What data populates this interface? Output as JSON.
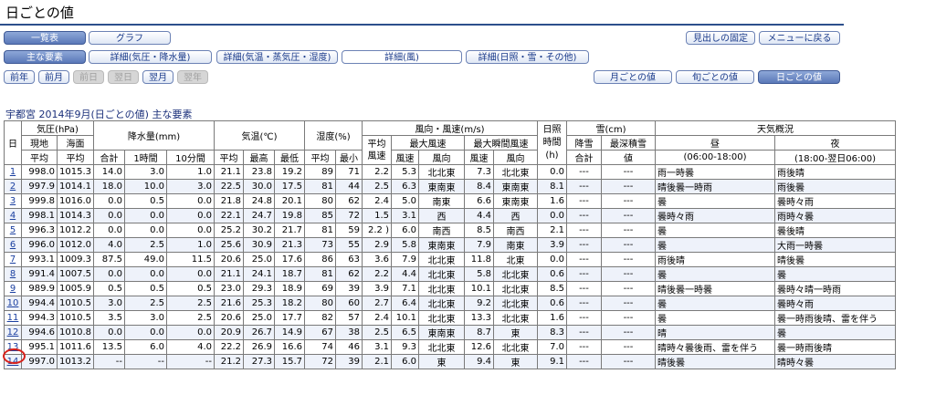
{
  "page": {
    "title": "日ごとの値"
  },
  "nav": {
    "row1": [
      {
        "label": "一覧表",
        "state": "active"
      },
      {
        "label": "グラフ",
        "state": "normal"
      }
    ],
    "row1_right": [
      {
        "label": "見出しの固定"
      },
      {
        "label": "メニューに戻る"
      }
    ],
    "row2": [
      {
        "label": "主な要素",
        "state": "active"
      },
      {
        "label": "詳細(気圧・降水量)",
        "state": "normal"
      },
      {
        "label": "詳細(気温・蒸気圧・湿度)",
        "state": "normal"
      },
      {
        "label": "詳細(風)",
        "state": "normal"
      },
      {
        "label": "詳細(日照・雪・その他)",
        "state": "normal"
      }
    ],
    "row3": [
      {
        "label": "前年",
        "state": "normal"
      },
      {
        "label": "前月",
        "state": "normal"
      },
      {
        "label": "前日",
        "state": "disabled"
      },
      {
        "label": "翌日",
        "state": "disabled"
      },
      {
        "label": "翌月",
        "state": "normal"
      },
      {
        "label": "翌年",
        "state": "disabled"
      }
    ],
    "row3_right": [
      {
        "label": "月ごとの値",
        "state": "normal"
      },
      {
        "label": "旬ごとの値",
        "state": "normal"
      },
      {
        "label": "日ごとの値",
        "state": "active"
      }
    ]
  },
  "table_title": "宇都宮 2014年9月(日ごとの値) 主な要素",
  "headers": {
    "day": "日",
    "pressure": "気圧(hPa)",
    "p_local": "現地",
    "p_sea": "海面",
    "avg": "平均",
    "precip": "降水量(mm)",
    "total": "合計",
    "max": "最大",
    "h1": "1時間",
    "m10": "10分間",
    "temp": "気温(℃)",
    "t_max": "最高",
    "t_min": "最低",
    "humid": "湿度(%)",
    "h_min": "最小",
    "wind": "風向・風速(m/s)",
    "avg_wind": "平均\n風速",
    "max_wind": "最大風速",
    "gust": "最大瞬間風速",
    "speed": "風速",
    "dir": "風向",
    "sun": "日照\n時間\n(h)",
    "snow": "雪(cm)",
    "snowfall": "降雪",
    "snow_total": "合計",
    "snow_depth": "最深積雪",
    "value": "値",
    "weather": "天気概況",
    "day_w": "昼",
    "day_range": "(06:00-18:00)",
    "night": "夜",
    "night_range": "(18:00-翌日06:00)"
  },
  "rows": [
    [
      "1",
      "998.0",
      "1015.3",
      "14.0",
      "3.0",
      "1.0",
      "21.1",
      "23.8",
      "19.2",
      "89",
      "71",
      "2.2",
      "5.3",
      "北北東",
      "7.3",
      "北北東",
      "0.0",
      "---",
      "---",
      "雨一時曇",
      "雨後晴"
    ],
    [
      "2",
      "997.9",
      "1014.1",
      "18.0",
      "10.0",
      "3.0",
      "22.5",
      "30.0",
      "17.5",
      "81",
      "44",
      "2.5",
      "6.3",
      "東南東",
      "8.4",
      "東南東",
      "8.1",
      "---",
      "---",
      "晴後曇一時雨",
      "雨後曇"
    ],
    [
      "3",
      "999.8",
      "1016.0",
      "0.0",
      "0.5",
      "0.0",
      "21.8",
      "24.8",
      "20.1",
      "80",
      "62",
      "2.4",
      "5.0",
      "南東",
      "6.6",
      "東南東",
      "1.6",
      "---",
      "---",
      "曇",
      "曇時々雨"
    ],
    [
      "4",
      "998.1",
      "1014.3",
      "0.0",
      "0.0",
      "0.0",
      "22.1",
      "24.7",
      "19.8",
      "85",
      "72",
      "1.5",
      "3.1",
      "西",
      "4.4",
      "西",
      "0.0",
      "---",
      "---",
      "曇時々雨",
      "雨時々曇"
    ],
    [
      "5",
      "996.3",
      "1012.2",
      "0.0",
      "0.0",
      "0.0",
      "25.2",
      "30.2",
      "21.7",
      "81",
      "59",
      "2.2 )",
      "6.0",
      "南西",
      "8.5",
      "南西",
      "2.1",
      "---",
      "---",
      "曇",
      "曇後晴"
    ],
    [
      "6",
      "996.0",
      "1012.0",
      "4.0",
      "2.5",
      "1.0",
      "25.6",
      "30.9",
      "21.3",
      "73",
      "55",
      "2.9",
      "5.8",
      "東南東",
      "7.9",
      "南東",
      "3.9",
      "---",
      "---",
      "曇",
      "大雨一時曇"
    ],
    [
      "7",
      "993.1",
      "1009.3",
      "87.5",
      "49.0",
      "11.5",
      "20.6",
      "25.0",
      "17.6",
      "86",
      "63",
      "3.6",
      "7.9",
      "北北東",
      "11.8",
      "北東",
      "0.0",
      "---",
      "---",
      "雨後晴",
      "晴後曇"
    ],
    [
      "8",
      "991.4",
      "1007.5",
      "0.0",
      "0.0",
      "0.0",
      "21.1",
      "24.1",
      "18.7",
      "81",
      "62",
      "2.2",
      "4.4",
      "北北東",
      "5.8",
      "北北東",
      "0.6",
      "---",
      "---",
      "曇",
      "曇"
    ],
    [
      "9",
      "989.9",
      "1005.9",
      "0.5",
      "0.5",
      "0.5",
      "23.0",
      "29.3",
      "18.9",
      "69",
      "39",
      "3.9",
      "7.1",
      "北北東",
      "10.1",
      "北北東",
      "8.5",
      "---",
      "---",
      "晴後曇一時曇",
      "曇時々晴一時雨"
    ],
    [
      "10",
      "994.4",
      "1010.5",
      "3.0",
      "2.5",
      "2.5",
      "21.6",
      "25.3",
      "18.2",
      "80",
      "60",
      "2.7",
      "6.4",
      "北北東",
      "9.2",
      "北北東",
      "0.6",
      "---",
      "---",
      "曇",
      "曇時々雨"
    ],
    [
      "11",
      "994.3",
      "1010.5",
      "3.5",
      "3.0",
      "2.5",
      "20.6",
      "25.0",
      "17.7",
      "82",
      "57",
      "2.4",
      "10.1",
      "北北東",
      "13.3",
      "北北東",
      "1.6",
      "---",
      "---",
      "曇",
      "曇一時雨後晴、雷を伴う"
    ],
    [
      "12",
      "994.6",
      "1010.8",
      "0.0",
      "0.0",
      "0.0",
      "20.9",
      "26.7",
      "14.9",
      "67",
      "38",
      "2.5",
      "6.5",
      "東南東",
      "8.7",
      "東",
      "8.3",
      "---",
      "---",
      "晴",
      "曇"
    ],
    [
      "13",
      "995.1",
      "1011.6",
      "13.5",
      "6.0",
      "4.0",
      "22.2",
      "26.9",
      "16.6",
      "74",
      "46",
      "3.1",
      "9.3",
      "北北東",
      "12.6",
      "北北東",
      "7.0",
      "---",
      "---",
      "晴時々曇後雨、雷を伴う",
      "曇一時雨後晴"
    ],
    [
      "14",
      "997.0",
      "1013.2",
      "--",
      "--",
      "--",
      "21.2",
      "27.3",
      "15.7",
      "72",
      "39",
      "2.1",
      "6.0",
      "東",
      "9.4",
      "東",
      "9.1",
      "---",
      "---",
      "晴後曇",
      "晴時々曇"
    ]
  ]
}
